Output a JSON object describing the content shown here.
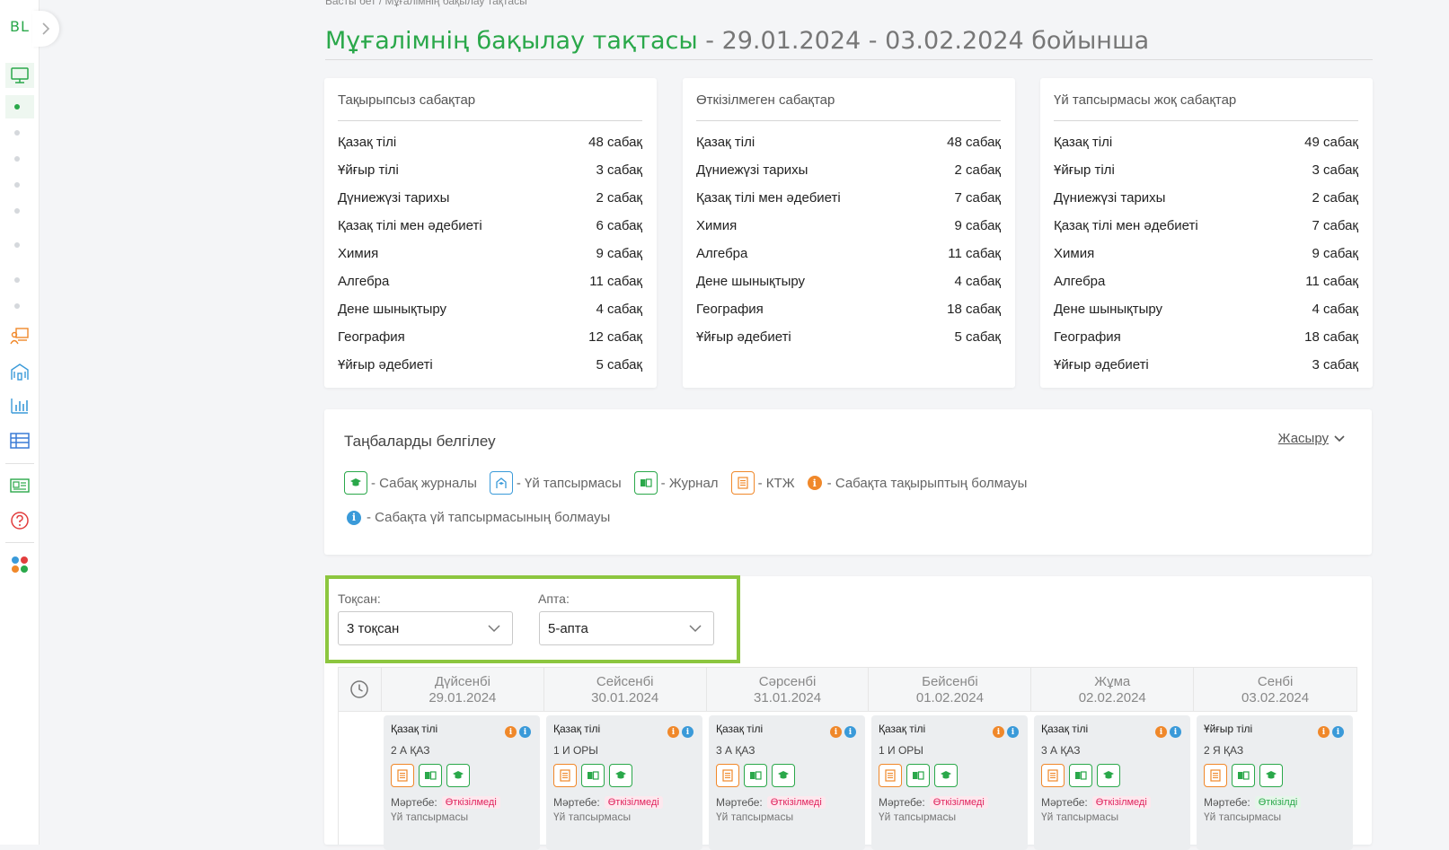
{
  "sidebar": {
    "logo": "BL",
    "icons": [
      "monitor-icon",
      "teacher-board-icon",
      "school-icon",
      "bar-chart-icon",
      "table-icon",
      "news-icon",
      "help-icon",
      "apps-icon"
    ]
  },
  "breadcrumb": "Басты бет  /  Мұғалімнің бақылау тақтасы",
  "title": {
    "main": "Мұғалімнің бақылау тақтасы",
    "range": " - 29.01.2024 - 03.02.2024 бойынша"
  },
  "stats": [
    {
      "title": "Тақырыпсыз сабақтар",
      "rows": [
        {
          "subject": "Қазақ тілі",
          "count": "48 сабақ"
        },
        {
          "subject": "Ұйғыр тілі",
          "count": "3 сабақ"
        },
        {
          "subject": "Дүниежүзі тарихы",
          "count": "2 сабақ"
        },
        {
          "subject": "Қазақ тілі мен әдебиеті",
          "count": "6 сабақ"
        },
        {
          "subject": "Химия",
          "count": "9 сабақ"
        },
        {
          "subject": "Алгебра",
          "count": "11 сабақ"
        },
        {
          "subject": "Дене шынықтыру",
          "count": "4 сабақ"
        },
        {
          "subject": "География",
          "count": "12 сабақ"
        },
        {
          "subject": "Ұйғыр әдебиеті",
          "count": "5 сабақ"
        }
      ]
    },
    {
      "title": "Өткізілмеген сабақтар",
      "rows": [
        {
          "subject": "Қазақ тілі",
          "count": "48 сабақ"
        },
        {
          "subject": "Дүниежүзі тарихы",
          "count": "2 сабақ"
        },
        {
          "subject": "Қазақ тілі мен әдебиеті",
          "count": "7 сабақ"
        },
        {
          "subject": "Химия",
          "count": "9 сабақ"
        },
        {
          "subject": "Алгебра",
          "count": "11 сабақ"
        },
        {
          "subject": "Дене шынықтыру",
          "count": "4 сабақ"
        },
        {
          "subject": "География",
          "count": "18 сабақ"
        },
        {
          "subject": "Ұйғыр әдебиеті",
          "count": "5 сабақ"
        }
      ]
    },
    {
      "title": "Үй тапсырмасы жоқ сабақтар",
      "rows": [
        {
          "subject": "Қазақ тілі",
          "count": "49 сабақ"
        },
        {
          "subject": "Ұйғыр тілі",
          "count": "3 сабақ"
        },
        {
          "subject": "Дүниежүзі тарихы",
          "count": "2 сабақ"
        },
        {
          "subject": "Қазақ тілі мен әдебиеті",
          "count": "7 сабақ"
        },
        {
          "subject": "Химия",
          "count": "9 сабақ"
        },
        {
          "subject": "Алгебра",
          "count": "11 сабақ"
        },
        {
          "subject": "Дене шынықтыру",
          "count": "4 сабақ"
        },
        {
          "subject": "География",
          "count": "18 сабақ"
        },
        {
          "subject": "Ұйғыр әдебиеті",
          "count": "3 сабақ"
        }
      ]
    }
  ],
  "legend": {
    "title": "Таңбаларды белгілеу",
    "hide_label": "Жасыру",
    "items": {
      "lesson_journal": "- Сабақ журналы",
      "homework": "- Үй тапсырмасы",
      "journal": "- Журнал",
      "ktzh": "- КТЖ",
      "no_topic": "- Сабақта тақырыптың болмауы",
      "no_homework": "- Сабақта үй тапсырмасының болмауы"
    }
  },
  "filters": {
    "quarter_label": "Тоқсан:",
    "quarter_value": "3 тоқсан",
    "week_label": "Апта:",
    "week_value": "5-апта"
  },
  "days": [
    {
      "name": "Дүйсенбі",
      "date": "29.01.2024"
    },
    {
      "name": "Сейсенбі",
      "date": "30.01.2024"
    },
    {
      "name": "Сәрсенбі",
      "date": "31.01.2024"
    },
    {
      "name": "Бейсенбі",
      "date": "01.02.2024"
    },
    {
      "name": "Жұма",
      "date": "02.02.2024"
    },
    {
      "name": "Сенбі",
      "date": "03.02.2024"
    }
  ],
  "lessons": [
    {
      "subject": "Қазақ тілі",
      "class": "2 А ҚАЗ",
      "status_label": "Мәртебе:",
      "status": "Өткізілмеді",
      "status_type": "red",
      "hw": "Үй тапсырмасы"
    },
    {
      "subject": "Қазақ тілі",
      "class": "1 И ОРЫ",
      "status_label": "Мәртебе:",
      "status": "Өткізілмеді",
      "status_type": "red",
      "hw": "Үй тапсырмасы"
    },
    {
      "subject": "Қазақ тілі",
      "class": "3 А ҚАЗ",
      "status_label": "Мәртебе:",
      "status": "Өткізілмеді",
      "status_type": "red",
      "hw": "Үй тапсырмасы"
    },
    {
      "subject": "Қазақ тілі",
      "class": "1 И ОРЫ",
      "status_label": "Мәртебе:",
      "status": "Өткізілмеді",
      "status_type": "red",
      "hw": "Үй тапсырмасы"
    },
    {
      "subject": "Қазақ тілі",
      "class": "3 А ҚАЗ",
      "status_label": "Мәртебе:",
      "status": "Өткізілмеді",
      "status_type": "red",
      "hw": "Үй тапсырмасы"
    },
    {
      "subject": "Ұйғыр тілі",
      "class": "2 Я ҚАЗ",
      "status_label": "Мәртебе:",
      "status": "Өткізілді",
      "status_type": "green",
      "hw": "Үй тапсырмасы"
    }
  ],
  "colors": {
    "brand_green": "#2aa84a",
    "highlight_lime": "#8cc63f",
    "orange": "#f0882a",
    "blue": "#3a9ad9"
  }
}
